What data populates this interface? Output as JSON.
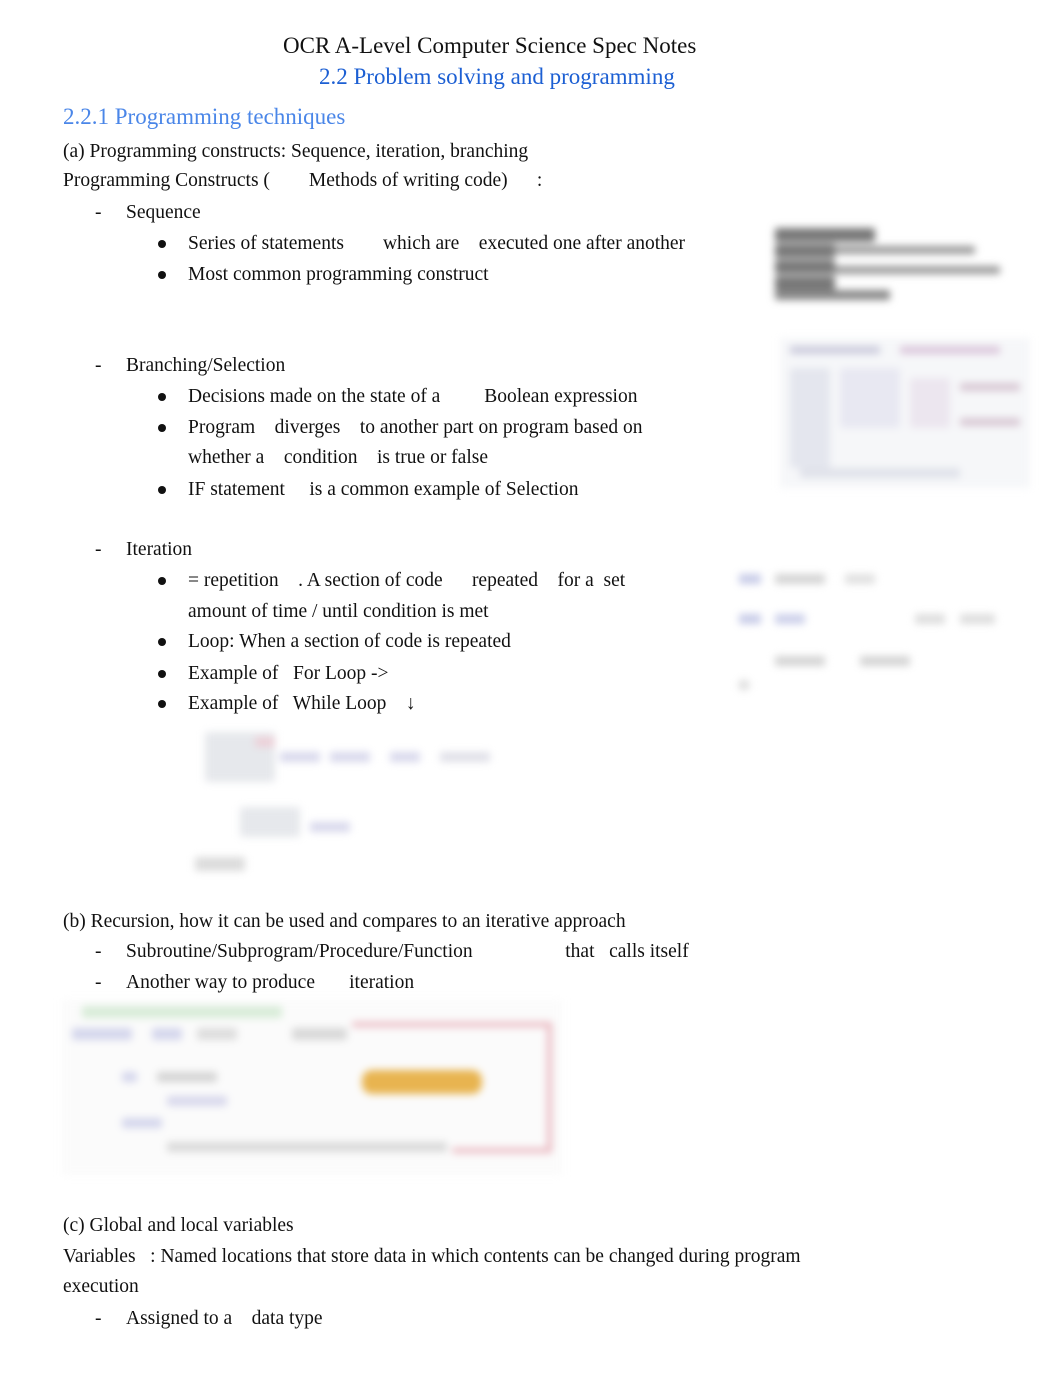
{
  "header": {
    "title": "OCR A-Level Computer Science Spec Notes",
    "subtitle": "2.2 Problem solving and programming"
  },
  "section": {
    "heading": "2.2.1 Programming techniques",
    "part_a": {
      "heading": "(a) Programming constructs: Sequence, iteration, branching",
      "intro": "Programming Constructs (        Methods of writing code)      :",
      "items": [
        {
          "label": "Sequence",
          "bullets": [
            "Series of statements        which are    executed one after another",
            "Most common programming construct"
          ]
        },
        {
          "label": "Branching/Selection",
          "bullets": [
            "Decisions made on the state of a         Boolean expression",
            "Program    diverges    to another part on program based on",
            "whether a    condition    is true or false",
            "IF statement     is a common example of Selection"
          ]
        },
        {
          "label": "Iteration",
          "bullets": [
            "= repetition    . A section of code      repeated    for a  set",
            "amount of time / until condition is met",
            "Loop: When a section of code is repeated",
            "Example of   For Loop ->",
            "Example of   While Loop    ↓"
          ]
        }
      ]
    },
    "part_b": {
      "heading": "(b) Recursion, how it can be used and compares to an iterative approach",
      "items": [
        "Subroutine/Subprogram/Procedure/Function                   that   calls itself",
        "Another way to produce       iteration"
      ]
    },
    "part_c": {
      "heading": "(c) Global and local variables",
      "definition_line1": "Variables   : Named locations that store data in which contents can be changed during program",
      "definition_line2": "execution",
      "items": [
        "Assigned to a    data type"
      ]
    }
  },
  "images": {
    "sequence_code": "blurred code screenshot (sequence example)",
    "selection_code": "blurred code screenshot (selection example)",
    "for_loop_code": "blurred code screenshot (for loop example)",
    "while_loop_code": "blurred code screenshot (while loop example)",
    "recursion_code": "blurred code screenshot (recursion example)"
  },
  "colors": {
    "title_blue": "#1c5fd3",
    "heading_blue": "#4a86e8",
    "text": "#111111"
  }
}
